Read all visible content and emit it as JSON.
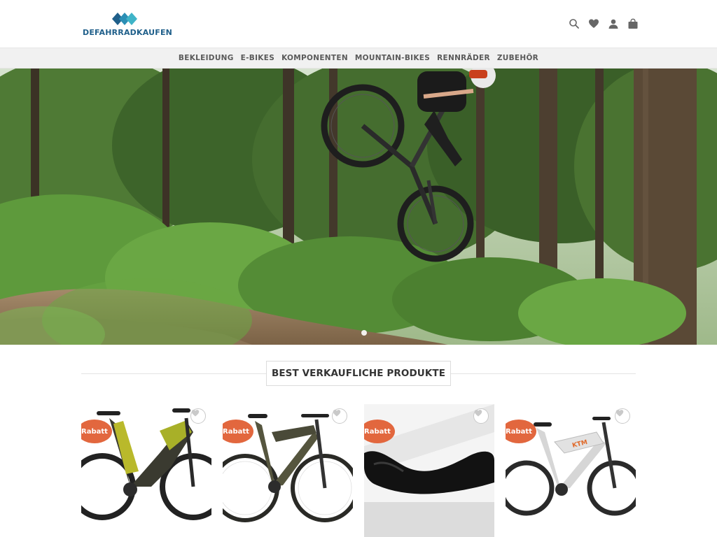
{
  "header": {
    "logo_text": "DEFAHRRADKAUFEN",
    "icons": [
      "search-icon",
      "heart-icon",
      "user-icon",
      "cart-icon"
    ]
  },
  "nav": {
    "items": [
      {
        "label": "BEKLEIDUNG"
      },
      {
        "label": "E-BIKES"
      },
      {
        "label": "KOMPONENTEN"
      },
      {
        "label": "MOUNTAIN-BIKES"
      },
      {
        "label": "RENNRÄDER"
      },
      {
        "label": "ZUBEHÖR"
      }
    ]
  },
  "hero": {
    "slider_dots": 1,
    "active_dot": 1
  },
  "section": {
    "title": "BEST VERKAUFLICHE PRODUKTE"
  },
  "products": [
    {
      "badge": "Rabatt",
      "image": "yellow-black-e-mtb"
    },
    {
      "badge": "Rabatt",
      "image": "dark-olive-e-mtb"
    },
    {
      "badge": "Rabatt",
      "image": "black-bike-component"
    },
    {
      "badge": "Rabatt",
      "image": "white-ktm-e-mtb"
    }
  ],
  "colors": {
    "brand_blue": "#1f5f8a",
    "badge_orange": "#e2673e",
    "nav_bg": "#f1f1f1"
  }
}
